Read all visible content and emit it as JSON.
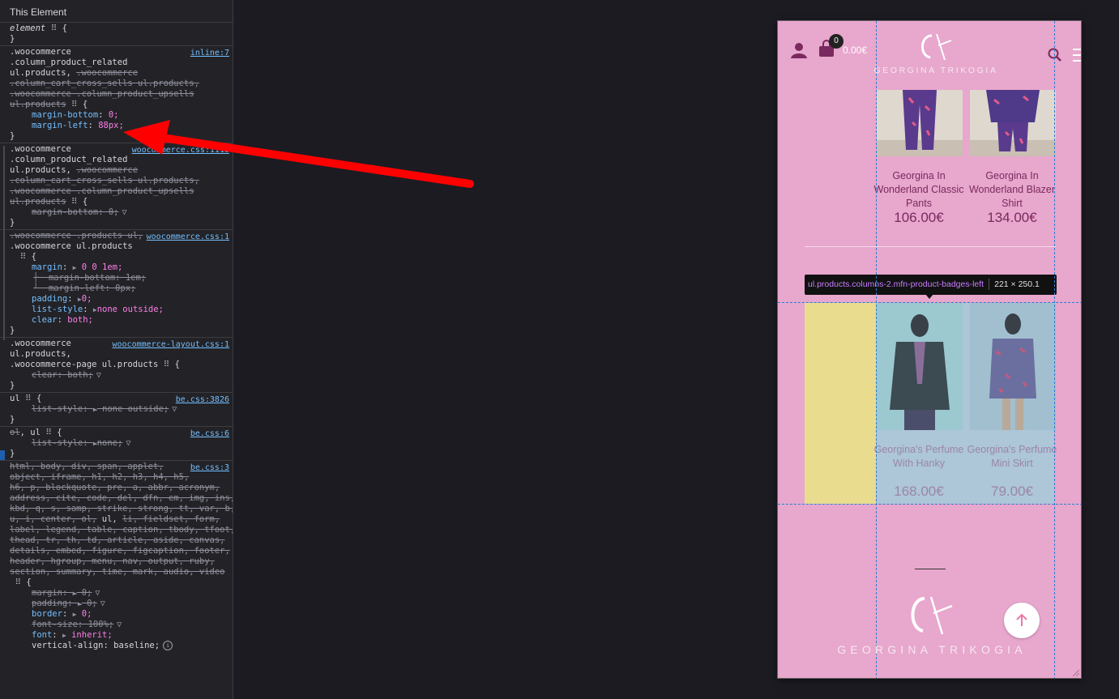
{
  "devtools": {
    "header": "This Element",
    "rules": [
      {
        "selector_lines": [
          "element ⠿ {"
        ],
        "decls": [],
        "close": "}"
      },
      {
        "source": "inline:7",
        "selector_lines": [
          ".woocommerce",
          ".column_product_related",
          "ul.products, .woocommerce",
          ".column_cart_cross_sells ul.products,",
          ".woocommerce .column_product_upsells",
          "ul.products ⠿ {"
        ],
        "decls": [
          {
            "name": "margin-bottom",
            "value": "0;"
          },
          {
            "name": "margin-left",
            "value": "88px;"
          }
        ],
        "close": "}"
      },
      {
        "source": "woocommerce.css:1113",
        "selector_lines": [
          ".woocommerce",
          ".column_product_related",
          "ul.products, .woocommerce",
          ".column_cart_cross_sells ul.products,",
          ".woocommerce .column_product_upsells",
          "ul.products ⠿ {"
        ],
        "decls": [
          {
            "name": "margin-bottom",
            "value": "0;"
          }
        ],
        "close": "}"
      },
      {
        "source": "woocommerce.css:1",
        "selector_lines": [
          ".woocommerce .products ul,",
          ".woocommerce ul.products",
          "⠿ {"
        ],
        "decls": [
          {
            "name": "margin",
            "value": "0 0 1em;"
          },
          {
            "name": "margin-bottom",
            "value": "1em;"
          },
          {
            "name": "margin-left",
            "value": "0px;"
          },
          {
            "name": "padding",
            "value": "0;"
          },
          {
            "name": "list-style",
            "value": "none outside;"
          },
          {
            "name": "clear",
            "value": "both;"
          }
        ],
        "close": "}"
      },
      {
        "source": "woocommerce-layout.css:1",
        "selector_lines": [
          ".woocommerce",
          "ul.products,",
          ".woocommerce-page ul.products ⠿ {"
        ],
        "decls": [
          {
            "name": "clear",
            "value": "both;"
          }
        ],
        "close": "}"
      },
      {
        "source": "be.css:3826",
        "selector_lines": [
          "ul ⠿ {"
        ],
        "decls": [
          {
            "name": "list-style",
            "value": "none outside;"
          }
        ],
        "close": "}"
      },
      {
        "source": "be.css:6",
        "selector_lines": [
          "ol, ul ⠿ {"
        ],
        "decls": [
          {
            "name": "list-style",
            "value": "none;"
          }
        ],
        "close": "}"
      },
      {
        "source": "be.css:3",
        "selector_lines": [
          "html, body, div, span, applet,",
          "object, iframe, h1, h2, h3, h4, h5,",
          "h6, p, blockquote, pre, a, abbr, acronym,",
          "address, cite, code, del, dfn, em, img, ins,",
          "kbd, q, s, samp, strike, strong, tt, var, b,",
          "u, i, center, ol, ul, li, fieldset, form,",
          "label, legend, table, caption, tbody, tfoot,",
          "thead, tr, th, td, article, aside, canvas,",
          "details, embed, figure, figcaption, footer,",
          "header, hgroup, menu, nav, output, ruby,",
          "section, summary, time, mark, audio, video",
          "⠿ {"
        ],
        "decls": [
          {
            "name": "margin",
            "value": "0;"
          },
          {
            "name": "padding",
            "value": "0;"
          },
          {
            "name": "border",
            "value": "0;"
          },
          {
            "name": "font-size",
            "value": "100%;"
          },
          {
            "name": "font",
            "value": "inherit;"
          },
          {
            "name": "vertical-align",
            "value": "baseline;"
          }
        ],
        "close": ""
      }
    ]
  },
  "site": {
    "cart_count": "0",
    "cart_total": "0.00€",
    "brand": "GEORGINA TRIKOGIA",
    "products_row1": [
      {
        "name": "Georgina In Wonderland Classic Pants",
        "price": "106.00€"
      },
      {
        "name": "Georgina In Wonderland Blazer Shirt",
        "price": "134.00€"
      }
    ],
    "products_row2": [
      {
        "name": "Georgina's Perfume With Hanky",
        "price": "168.00€"
      },
      {
        "name": "Georgina's Perfume Mini Skirt",
        "price": "79.00€"
      }
    ],
    "tooltip": {
      "selector": "ul.products.columns-2.mfn-product-badges-left",
      "dims": "221 × 250.1"
    }
  },
  "colors": {
    "site_background": "#e8a7cd",
    "margin_highlight": "#eadc8f",
    "content_highlight": "#96d2dc",
    "arrow": "#ff0000"
  }
}
